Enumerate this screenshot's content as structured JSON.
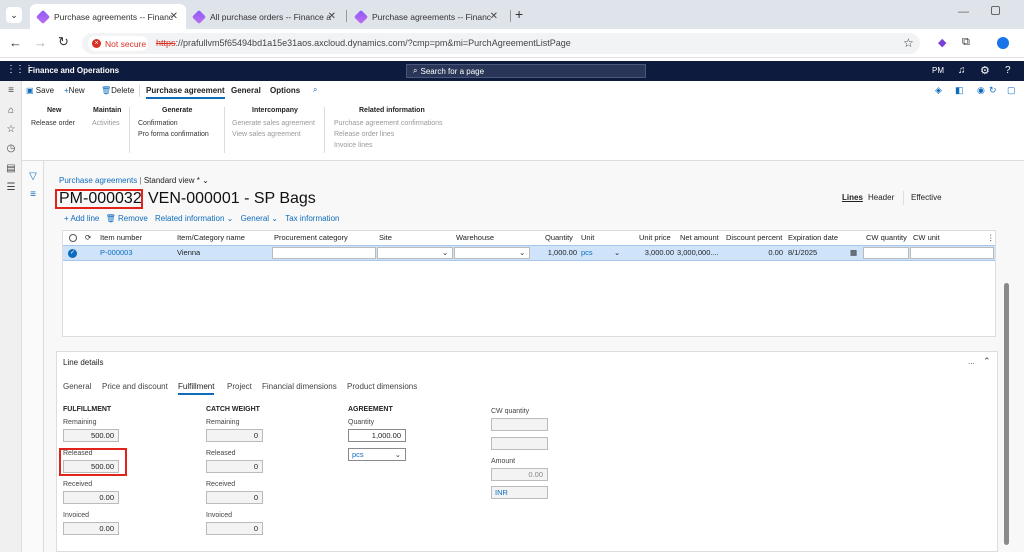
{
  "browser": {
    "tabs": [
      {
        "label": "Purchase agreements -- Financ",
        "active": true
      },
      {
        "label": "All purchase orders -- Finance a",
        "active": false
      },
      {
        "label": "Purchase agreements -- Financ",
        "active": false
      }
    ],
    "security_label": "Not secure",
    "url_scheme": "https",
    "url_rest": "://prafullvm5f65494bd1a15e31aos.axcloud.dynamics.com/?cmp=pm&mi=PurchAgreementListPage"
  },
  "app": {
    "name": "Finance and Operations",
    "search_placeholder": "Search for a page",
    "user_initials": "PM"
  },
  "toolbar": {
    "save": "Save",
    "new": "New",
    "delete": "Delete",
    "tabs": [
      "Purchase agreement",
      "General",
      "Options"
    ]
  },
  "action_groups": {
    "new": {
      "title": "New",
      "items": [
        "Release order"
      ]
    },
    "maintain": {
      "title": "Maintain",
      "items": [
        "Activities"
      ]
    },
    "generate": {
      "title": "Generate",
      "items": [
        "Confirmation",
        "Pro forma confirmation"
      ]
    },
    "intercompany": {
      "title": "Intercompany",
      "items": [
        "Generate sales agreement",
        "View sales agreement"
      ]
    },
    "related": {
      "title": "Related information",
      "items": [
        "Purchase agreement confirmations",
        "Release order lines",
        "Invoice lines"
      ]
    }
  },
  "page": {
    "breadcrumb": "Purchase agreements",
    "view": "Standard view *",
    "agreement_id": "PM-000032",
    "vendor_title": "VEN-000001 - SP Bags",
    "view_tabs": [
      "Lines",
      "Header"
    ],
    "effective_label": "Effective"
  },
  "lines_toolbar": [
    "Add line",
    "Remove",
    "Related information",
    "General",
    "Tax information"
  ],
  "grid": {
    "columns": [
      "Item number",
      "Item/Category name",
      "Procurement category",
      "Site",
      "Warehouse",
      "Quantity",
      "Unit",
      "Unit price",
      "Net amount",
      "Discount percent",
      "Expiration date",
      "CW quantity",
      "CW unit"
    ],
    "row": {
      "item_number": "P-000003",
      "item_name": "Vienna",
      "quantity": "1,000.00",
      "unit": "pcs",
      "unit_price": "3,000.00",
      "net_amount": "3,000,000....",
      "discount": "0.00",
      "expiration": "8/1/2025"
    }
  },
  "line_details": {
    "title": "Line details",
    "tabs": [
      "General",
      "Price and discount",
      "Fulfillment",
      "Project",
      "Financial dimensions",
      "Product dimensions"
    ],
    "active_tab": "Fulfillment",
    "fulfillment": {
      "title": "FULFILLMENT",
      "remaining_label": "Remaining",
      "remaining": "500.00",
      "released_label": "Released",
      "released": "500.00",
      "received_label": "Received",
      "received": "0.00",
      "invoiced_label": "Invoiced",
      "invoiced": "0.00"
    },
    "catch_weight": {
      "title": "CATCH WEIGHT",
      "remaining_label": "Remaining",
      "remaining": "0",
      "released_label": "Released",
      "released": "0",
      "received_label": "Received",
      "received": "0",
      "invoiced_label": "Invoiced",
      "invoiced": "0"
    },
    "agreement": {
      "title": "AGREEMENT",
      "quantity_label": "Quantity",
      "quantity": "1,000.00",
      "unit": "pcs"
    },
    "cw": {
      "cw_quantity_label": "CW quantity",
      "amount_label": "Amount",
      "amount": "0.00",
      "currency": "INR"
    }
  },
  "colors": {
    "accent": "#0f6cbd",
    "highlight": "#e0241b",
    "app_header": "#0d1b3e"
  }
}
